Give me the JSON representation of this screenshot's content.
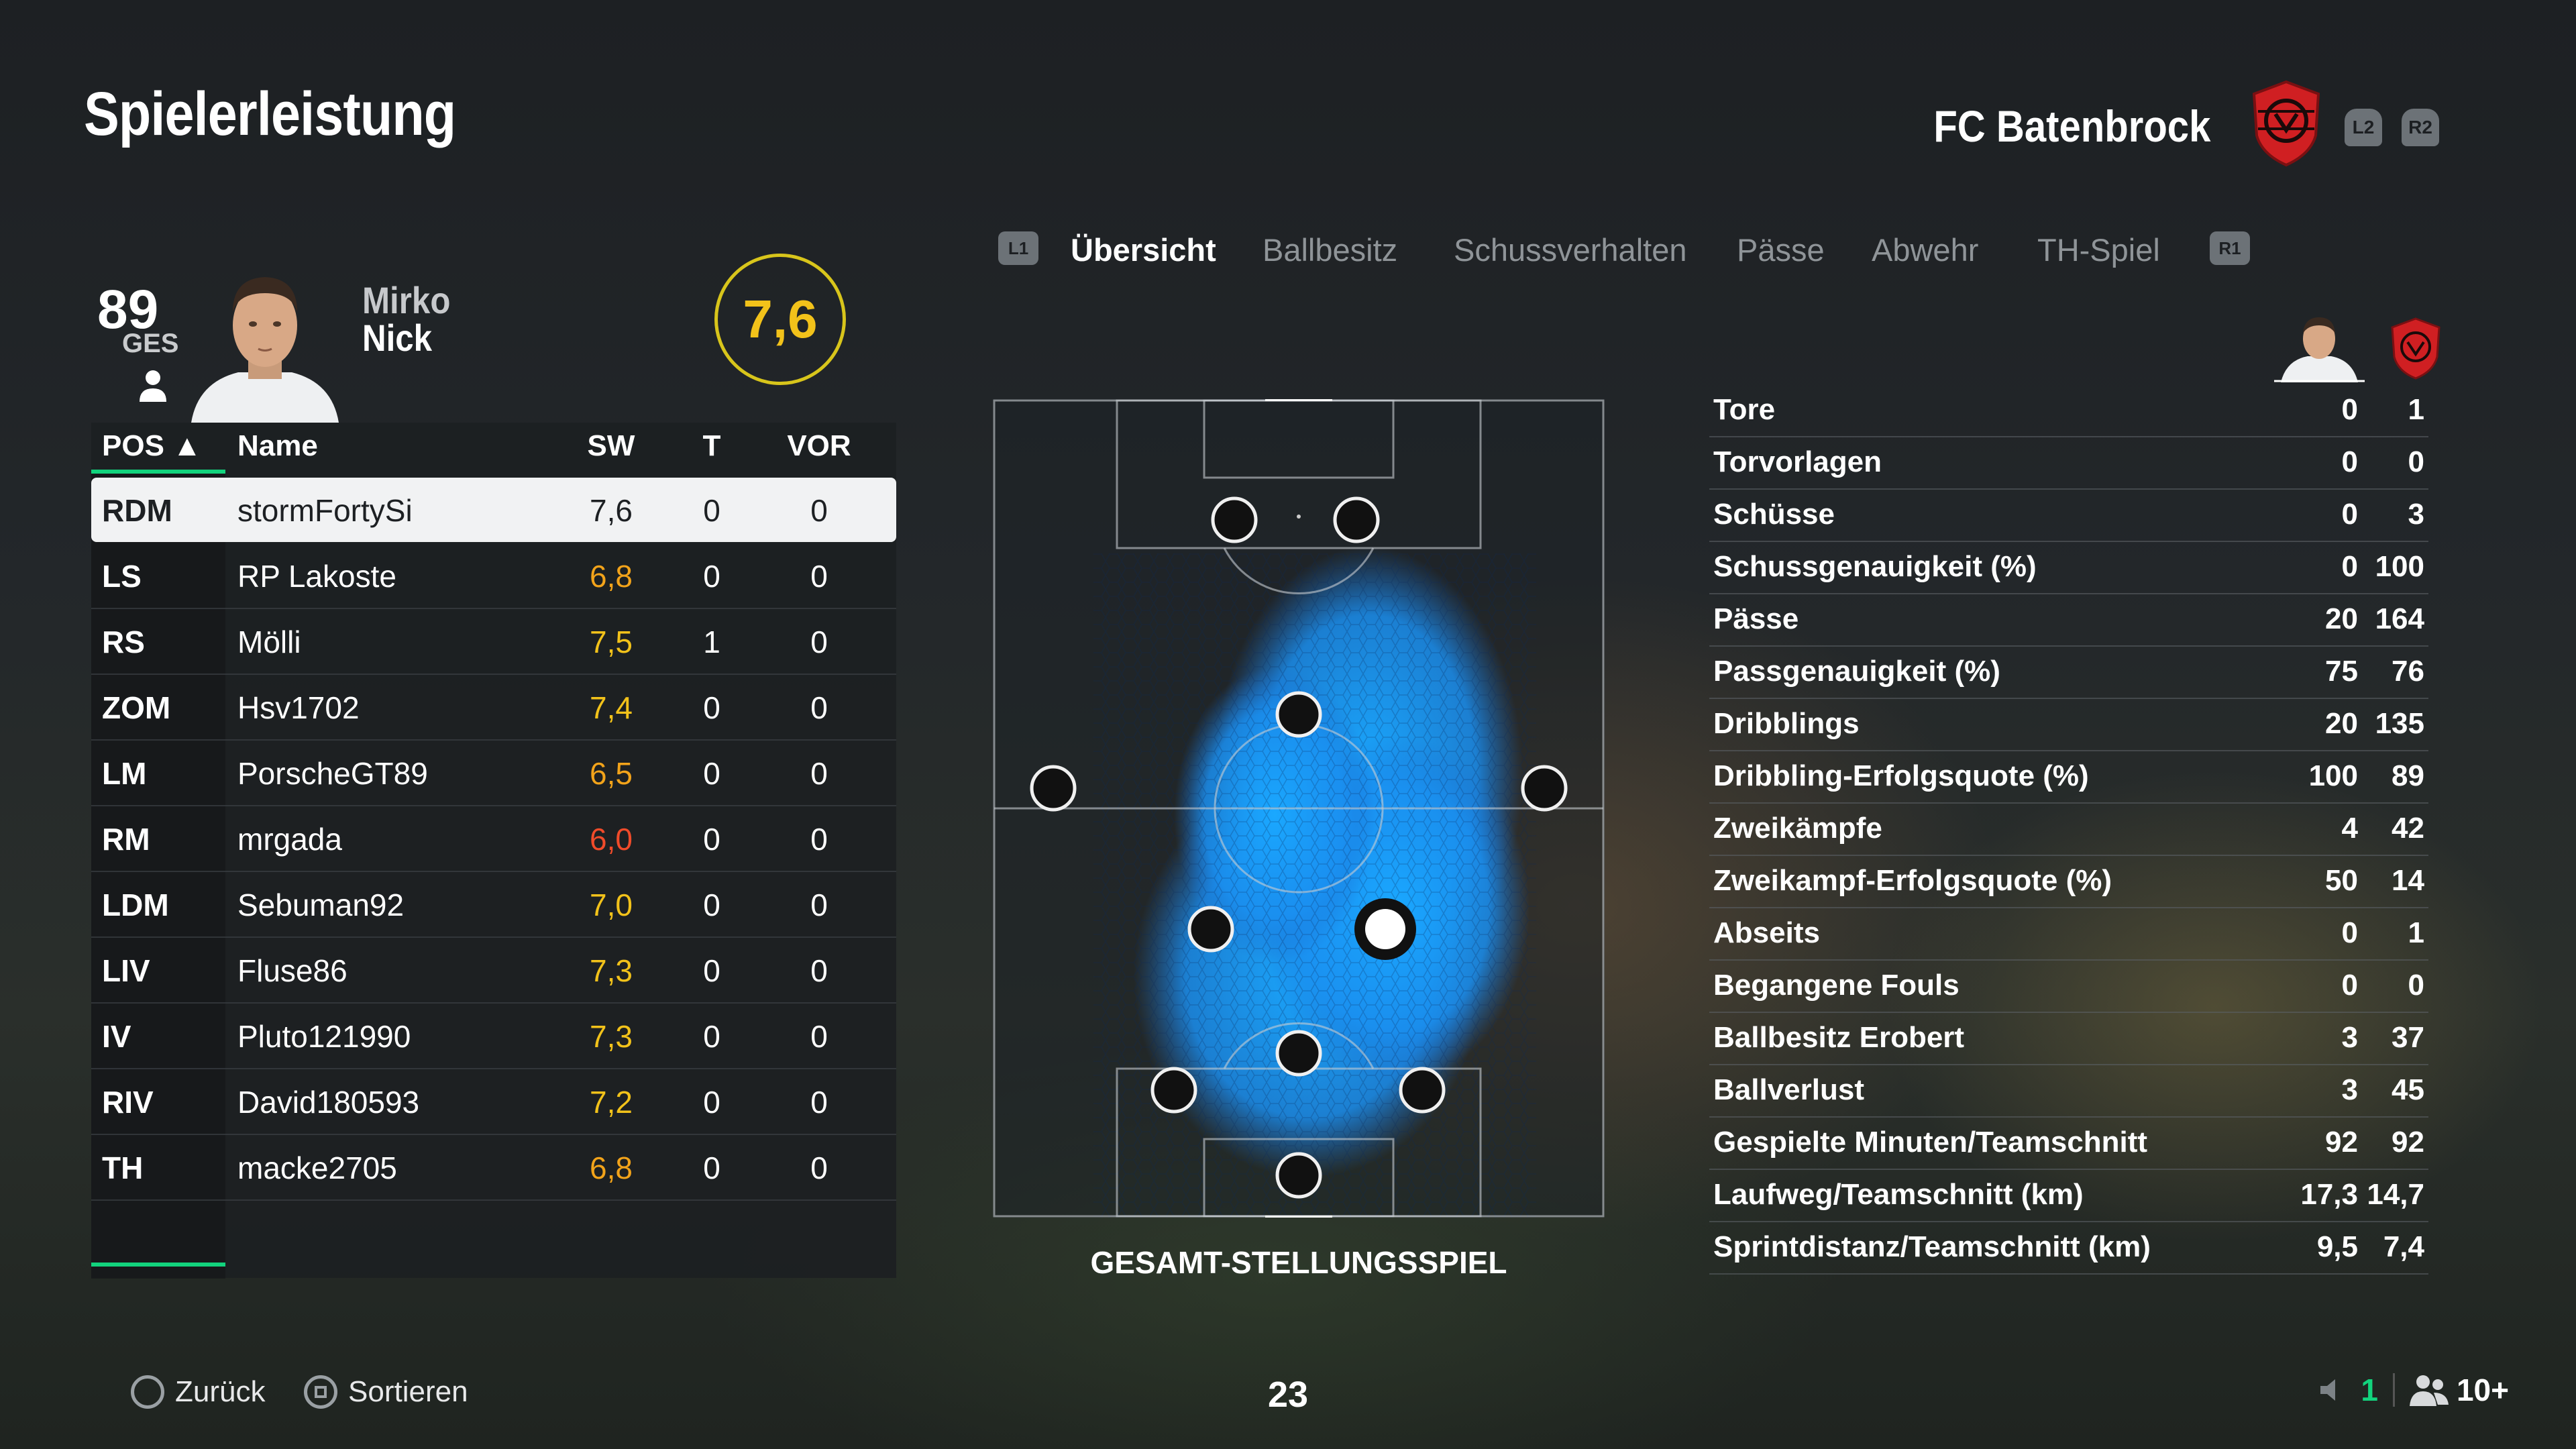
{
  "header": {
    "title": "Spielerleistung",
    "club_name": "FC Batenbrock",
    "l2": "L2",
    "r2": "R2"
  },
  "player": {
    "overall": "89",
    "overall_caption": "GES",
    "first_name": "Mirko",
    "last_name": "Nick",
    "match_rating": "7,6"
  },
  "table": {
    "headers": {
      "pos": "POS ▲",
      "name": "Name",
      "sw": "SW",
      "t": "T",
      "vor": "VOR"
    },
    "rows": [
      {
        "pos": "RDM",
        "name": "stormFortySi",
        "sw": "7,6",
        "t": "0",
        "vor": "0",
        "sw_color": "#1d2023"
      },
      {
        "pos": "LS",
        "name": "RP Lakoste",
        "sw": "6,8",
        "t": "0",
        "vor": "0",
        "sw_color": "#f2a31a"
      },
      {
        "pos": "RS",
        "name": "Mölli",
        "sw": "7,5",
        "t": "1",
        "vor": "0",
        "sw_color": "#f2c21a"
      },
      {
        "pos": "ZOM",
        "name": "Hsv1702",
        "sw": "7,4",
        "t": "0",
        "vor": "0",
        "sw_color": "#f2c21a"
      },
      {
        "pos": "LM",
        "name": "PorscheGT89",
        "sw": "6,5",
        "t": "0",
        "vor": "0",
        "sw_color": "#f2a31a"
      },
      {
        "pos": "RM",
        "name": "mrgada",
        "sw": "6,0",
        "t": "0",
        "vor": "0",
        "sw_color": "#f04b2a"
      },
      {
        "pos": "LDM",
        "name": "Sebuman92",
        "sw": "7,0",
        "t": "0",
        "vor": "0",
        "sw_color": "#f2c21a"
      },
      {
        "pos": "LIV",
        "name": "Fluse86",
        "sw": "7,3",
        "t": "0",
        "vor": "0",
        "sw_color": "#f2c21a"
      },
      {
        "pos": "IV",
        "name": "Pluto121990",
        "sw": "7,3",
        "t": "0",
        "vor": "0",
        "sw_color": "#f2c21a"
      },
      {
        "pos": "RIV",
        "name": "David180593",
        "sw": "7,2",
        "t": "0",
        "vor": "0",
        "sw_color": "#f2c21a"
      },
      {
        "pos": "TH",
        "name": "macke2705",
        "sw": "6,8",
        "t": "0",
        "vor": "0",
        "sw_color": "#f2a31a"
      }
    ]
  },
  "tabs": {
    "l1": "L1",
    "r1": "R1",
    "items": [
      "Übersicht",
      "Ballbesitz",
      "Schussverhalten",
      "Pässe",
      "Abwehr",
      "TH-Spiel"
    ],
    "active_index": 0
  },
  "pitch": {
    "label": "GESAMT-STELLUNGSSPIEL"
  },
  "stats": [
    {
      "label": "Tore",
      "player": "0",
      "team": "1"
    },
    {
      "label": "Torvorlagen",
      "player": "0",
      "team": "0"
    },
    {
      "label": "Schüsse",
      "player": "0",
      "team": "3"
    },
    {
      "label": "Schussgenauigkeit (%)",
      "player": "0",
      "team": "100"
    },
    {
      "label": "Pässe",
      "player": "20",
      "team": "164"
    },
    {
      "label": "Passgenauigkeit (%)",
      "player": "75",
      "team": "76"
    },
    {
      "label": "Dribblings",
      "player": "20",
      "team": "135"
    },
    {
      "label": "Dribbling-Erfolgsquote (%)",
      "player": "100",
      "team": "89"
    },
    {
      "label": "Zweikämpfe",
      "player": "4",
      "team": "42"
    },
    {
      "label": "Zweikampf-Erfolgsquote (%)",
      "player": "50",
      "team": "14"
    },
    {
      "label": "Abseits",
      "player": "0",
      "team": "1"
    },
    {
      "label": "Begangene Fouls",
      "player": "0",
      "team": "0"
    },
    {
      "label": "Ballbesitz Erobert",
      "player": "3",
      "team": "37"
    },
    {
      "label": "Ballverlust",
      "player": "3",
      "team": "45"
    },
    {
      "label": "Gespielte Minuten/Teamschnitt",
      "player": "92",
      "team": "92"
    },
    {
      "label": "Laufweg/Teamschnitt (km)",
      "player": "17,3",
      "team": "14,7"
    },
    {
      "label": "Sprintdistanz/Teamschnitt (km)",
      "player": "9,5",
      "team": "7,4"
    }
  ],
  "footer": {
    "back": "Zurück",
    "sort": "Sortieren",
    "page": "23",
    "voice_count": "1",
    "players": "10+"
  },
  "colors": {
    "accent_green": "#12d37d",
    "rating_ring": "#d8c51b",
    "heatmap_blue": "#1a9bff",
    "crest_red": "#d01f22"
  }
}
